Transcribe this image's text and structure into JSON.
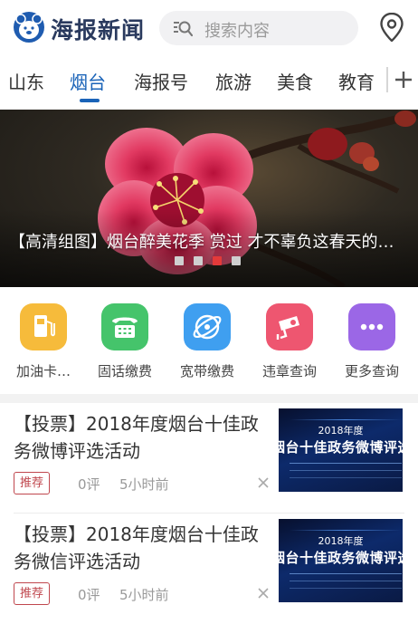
{
  "header": {
    "app_name": "海报新闻",
    "search_placeholder": "搜索内容",
    "logo_icon": "bear-face-logo",
    "location_icon": "map-pin-icon"
  },
  "tabs": [
    {
      "label": "山东",
      "active": false
    },
    {
      "label": "烟台",
      "active": true
    },
    {
      "label": "海报号",
      "active": false
    },
    {
      "label": "旅游",
      "active": false
    },
    {
      "label": "美食",
      "active": false
    },
    {
      "label": "教育",
      "active": false
    }
  ],
  "banner": {
    "caption": "【高清组图】烟台醉美花季 赏过 才不辜负这春天的…",
    "slide_count": 4,
    "active_slide": 3
  },
  "services": [
    {
      "label": "加油卡…",
      "icon": "fuel-pump-icon",
      "color": "#f6bb3b"
    },
    {
      "label": "固话缴费",
      "icon": "telephone-icon",
      "color": "#45c46b"
    },
    {
      "label": "宽带缴费",
      "icon": "globe-icon",
      "color": "#3f9ff0"
    },
    {
      "label": "违章查询",
      "icon": "traffic-camera-icon",
      "color": "#ee5670"
    },
    {
      "label": "更多查询",
      "icon": "more-dots-icon",
      "color": "#9b67e6"
    }
  ],
  "news": [
    {
      "title": "【投票】2018年度烟台十佳政务微博评选活动",
      "tag": "推荐",
      "comments": "0评",
      "time": "5小时前",
      "thumb_year": "2018年度",
      "thumb_title": "烟台十佳政务微博评选"
    },
    {
      "title": "【投票】2018年度烟台十佳政务微信评选活动",
      "tag": "推荐",
      "comments": "0评",
      "time": "5小时前",
      "thumb_year": "2018年度",
      "thumb_title": "烟台十佳政务微博评选"
    }
  ],
  "colors": {
    "brand_blue": "#1a63b8",
    "tag_red": "#c0474e",
    "active_dot": "#e33a3a"
  }
}
